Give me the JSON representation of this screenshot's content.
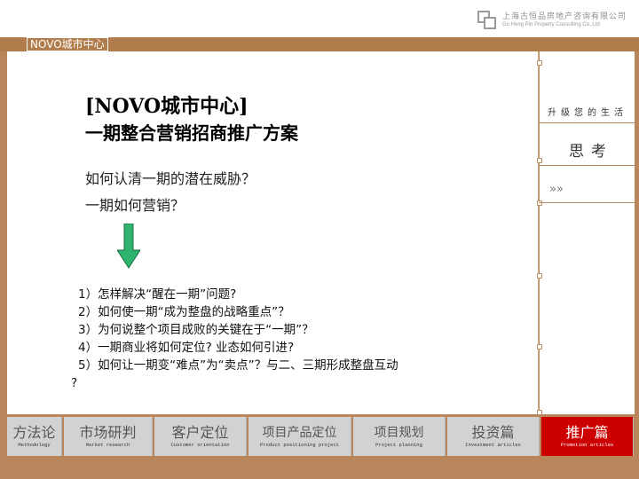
{
  "company": {
    "name_cn": "上海古恒品房地产咨询有限公司",
    "name_en": "Gu Heng Pin Property Consulting Co.,Ltd",
    "logo_icon": "gg-logo-icon"
  },
  "brand_tab": "NOVO城市中心",
  "main": {
    "title_line1": "[NOVO城市中心]",
    "title_line2": "一期整合营销招商推广方案",
    "question1": "如何认清一期的潜在威胁？",
    "question2": "一期如何营销？",
    "arrow_icon": "down-arrow-icon",
    "arrow_color": "#2fb36e",
    "list": [
      "1）怎样解决“醒在一期”问题?",
      "2）如何使一期“成为整盘的战略重点”？",
      "3）为何说整个项目成败的关键在于“一期”？",
      "4）一期商业将如何定位? 业态如何引进?",
      "5）如何让一期变“难点”为“卖点”？与二、三期形成整盘互动",
      "?"
    ]
  },
  "side": {
    "caption": "升级您的生活",
    "title": "思考",
    "chevron_icon": "double-chevron-right-icon",
    "chevron_glyph": "»»"
  },
  "nav": [
    {
      "cn": "方法论",
      "en": "Methodology",
      "active": false
    },
    {
      "cn": "市场研判",
      "en": "Market research",
      "active": false
    },
    {
      "cn": "客户定位",
      "en": "Customer orientation",
      "active": false
    },
    {
      "cn": "项目产品定位",
      "en": "Product positioning project",
      "active": false
    },
    {
      "cn": "项目规划",
      "en": "Project planning",
      "active": false
    },
    {
      "cn": "投资篇",
      "en": "Investment articles",
      "active": false
    },
    {
      "cn": "推广篇",
      "en": "Promotion articles",
      "active": true
    }
  ],
  "colors": {
    "frame": "#b8865a",
    "nav_active": "#cc0000",
    "nav_inactive": "#d2d2d2"
  }
}
